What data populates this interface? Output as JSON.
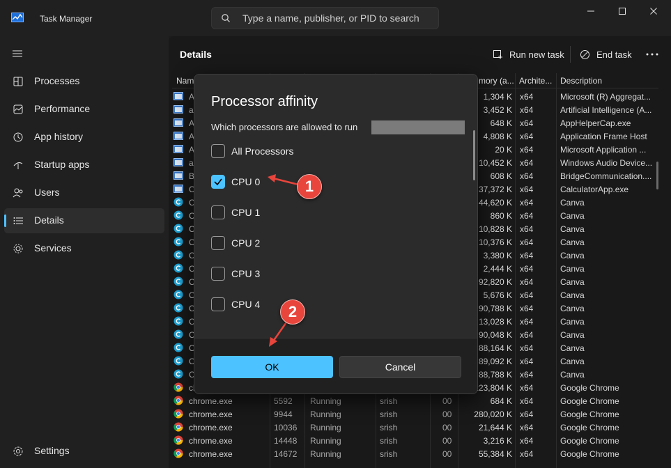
{
  "app": {
    "title": "Task Manager"
  },
  "search": {
    "placeholder": "Type a name, publisher, or PID to search"
  },
  "sidebar": {
    "items": [
      {
        "label": "Processes",
        "icon": "processes-icon"
      },
      {
        "label": "Performance",
        "icon": "performance-icon"
      },
      {
        "label": "App history",
        "icon": "app-history-icon"
      },
      {
        "label": "Startup apps",
        "icon": "startup-apps-icon"
      },
      {
        "label": "Users",
        "icon": "users-icon"
      },
      {
        "label": "Details",
        "icon": "details-icon",
        "active": true
      },
      {
        "label": "Services",
        "icon": "services-icon"
      }
    ],
    "settings_label": "Settings"
  },
  "toolbar": {
    "title": "Details",
    "run_new_task": "Run new task",
    "end_task": "End task"
  },
  "table": {
    "headers": {
      "name": "Nam",
      "memory": "mory (a...",
      "arch": "Archite...",
      "description": "Description"
    },
    "rows": [
      {
        "name": "Ag",
        "pid": "",
        "status": "",
        "user": "",
        "cpu": "",
        "mem": "1,304 K",
        "arch": "x64",
        "desc": "Microsoft (R) Aggregat...",
        "icon": "window"
      },
      {
        "name": "ai.",
        "pid": "",
        "status": "",
        "user": "",
        "cpu": "",
        "mem": "3,452 K",
        "arch": "x64",
        "desc": "Artificial Intelligence (A...",
        "icon": "window"
      },
      {
        "name": "Ap",
        "pid": "",
        "status": "",
        "user": "",
        "cpu": "",
        "mem": "648 K",
        "arch": "x64",
        "desc": "AppHelperCap.exe",
        "icon": "window"
      },
      {
        "name": "Ap",
        "pid": "",
        "status": "",
        "user": "",
        "cpu": "",
        "mem": "4,808 K",
        "arch": "x64",
        "desc": "Application Frame Host",
        "icon": "window"
      },
      {
        "name": "Ap",
        "pid": "",
        "status": "",
        "user": "",
        "cpu": "",
        "mem": "20 K",
        "arch": "x64",
        "desc": "Microsoft Application ...",
        "icon": "window"
      },
      {
        "name": "au",
        "pid": "",
        "status": "",
        "user": "",
        "cpu": "",
        "mem": "10,452 K",
        "arch": "x64",
        "desc": "Windows Audio Device...",
        "icon": "window"
      },
      {
        "name": "Bri",
        "pid": "",
        "status": "",
        "user": "",
        "cpu": "",
        "mem": "608 K",
        "arch": "x64",
        "desc": "BridgeCommunication....",
        "icon": "window"
      },
      {
        "name": "Ca",
        "pid": "",
        "status": "",
        "user": "",
        "cpu": "",
        "mem": "37,372 K",
        "arch": "x64",
        "desc": "CalculatorApp.exe",
        "icon": "window"
      },
      {
        "name": "Ca",
        "pid": "",
        "status": "",
        "user": "",
        "cpu": "",
        "mem": "44,620 K",
        "arch": "x64",
        "desc": "Canva",
        "icon": "canva"
      },
      {
        "name": "Ca",
        "pid": "",
        "status": "",
        "user": "",
        "cpu": "",
        "mem": "860 K",
        "arch": "x64",
        "desc": "Canva",
        "icon": "canva"
      },
      {
        "name": "Ca",
        "pid": "",
        "status": "",
        "user": "",
        "cpu": "",
        "mem": "10,828 K",
        "arch": "x64",
        "desc": "Canva",
        "icon": "canva"
      },
      {
        "name": "Ca",
        "pid": "",
        "status": "",
        "user": "",
        "cpu": "",
        "mem": "10,376 K",
        "arch": "x64",
        "desc": "Canva",
        "icon": "canva"
      },
      {
        "name": "Ca",
        "pid": "",
        "status": "",
        "user": "",
        "cpu": "",
        "mem": "3,380 K",
        "arch": "x64",
        "desc": "Canva",
        "icon": "canva"
      },
      {
        "name": "Ca",
        "pid": "",
        "status": "",
        "user": "",
        "cpu": "",
        "mem": "2,444 K",
        "arch": "x64",
        "desc": "Canva",
        "icon": "canva"
      },
      {
        "name": "Ca",
        "pid": "",
        "status": "",
        "user": "",
        "cpu": "",
        "mem": "92,820 K",
        "arch": "x64",
        "desc": "Canva",
        "icon": "canva"
      },
      {
        "name": "Ca",
        "pid": "",
        "status": "",
        "user": "",
        "cpu": "",
        "mem": "5,676 K",
        "arch": "x64",
        "desc": "Canva",
        "icon": "canva"
      },
      {
        "name": "Ca",
        "pid": "",
        "status": "",
        "user": "",
        "cpu": "",
        "mem": "90,788 K",
        "arch": "x64",
        "desc": "Canva",
        "icon": "canva"
      },
      {
        "name": "Ca",
        "pid": "",
        "status": "",
        "user": "",
        "cpu": "",
        "mem": "13,028 K",
        "arch": "x64",
        "desc": "Canva",
        "icon": "canva"
      },
      {
        "name": "Ca",
        "pid": "",
        "status": "",
        "user": "",
        "cpu": "",
        "mem": "90,048 K",
        "arch": "x64",
        "desc": "Canva",
        "icon": "canva"
      },
      {
        "name": "Ca",
        "pid": "",
        "status": "",
        "user": "",
        "cpu": "",
        "mem": "88,164 K",
        "arch": "x64",
        "desc": "Canva",
        "icon": "canva"
      },
      {
        "name": "Ca",
        "pid": "",
        "status": "",
        "user": "",
        "cpu": "",
        "mem": "89,092 K",
        "arch": "x64",
        "desc": "Canva",
        "icon": "canva"
      },
      {
        "name": "Ca",
        "pid": "",
        "status": "",
        "user": "",
        "cpu": "",
        "mem": "88,788 K",
        "arch": "x64",
        "desc": "Canva",
        "icon": "canva"
      },
      {
        "name": "ch",
        "pid": "",
        "status": "",
        "user": "",
        "cpu": "",
        "mem": "223,804 K",
        "arch": "x64",
        "desc": "Google Chrome",
        "icon": "chrome"
      },
      {
        "name": "chrome.exe",
        "pid": "5592",
        "status": "Running",
        "user": "srish",
        "cpu": "00",
        "mem": "684 K",
        "arch": "x64",
        "desc": "Google Chrome",
        "icon": "chrome"
      },
      {
        "name": "chrome.exe",
        "pid": "9944",
        "status": "Running",
        "user": "srish",
        "cpu": "00",
        "mem": "280,020 K",
        "arch": "x64",
        "desc": "Google Chrome",
        "icon": "chrome"
      },
      {
        "name": "chrome.exe",
        "pid": "10036",
        "status": "Running",
        "user": "srish",
        "cpu": "00",
        "mem": "21,644 K",
        "arch": "x64",
        "desc": "Google Chrome",
        "icon": "chrome"
      },
      {
        "name": "chrome.exe",
        "pid": "14448",
        "status": "Running",
        "user": "srish",
        "cpu": "00",
        "mem": "3,216 K",
        "arch": "x64",
        "desc": "Google Chrome",
        "icon": "chrome"
      },
      {
        "name": "chrome.exe",
        "pid": "14672",
        "status": "Running",
        "user": "srish",
        "cpu": "00",
        "mem": "55,384 K",
        "arch": "x64",
        "desc": "Google Chrome",
        "icon": "chrome"
      }
    ]
  },
  "dialog": {
    "title": "Processor affinity",
    "subtitle": "Which processors are allowed to run",
    "options": [
      {
        "label": "All Processors",
        "checked": false
      },
      {
        "label": "CPU 0",
        "checked": true
      },
      {
        "label": "CPU 1",
        "checked": false
      },
      {
        "label": "CPU 2",
        "checked": false
      },
      {
        "label": "CPU 3",
        "checked": false
      },
      {
        "label": "CPU 4",
        "checked": false
      }
    ],
    "ok_label": "OK",
    "cancel_label": "Cancel"
  },
  "annotations": {
    "step1": "1",
    "step2": "2"
  },
  "colors": {
    "accent": "#4cc2ff",
    "callout": "#e8453c",
    "background": "#1c1c1c"
  }
}
